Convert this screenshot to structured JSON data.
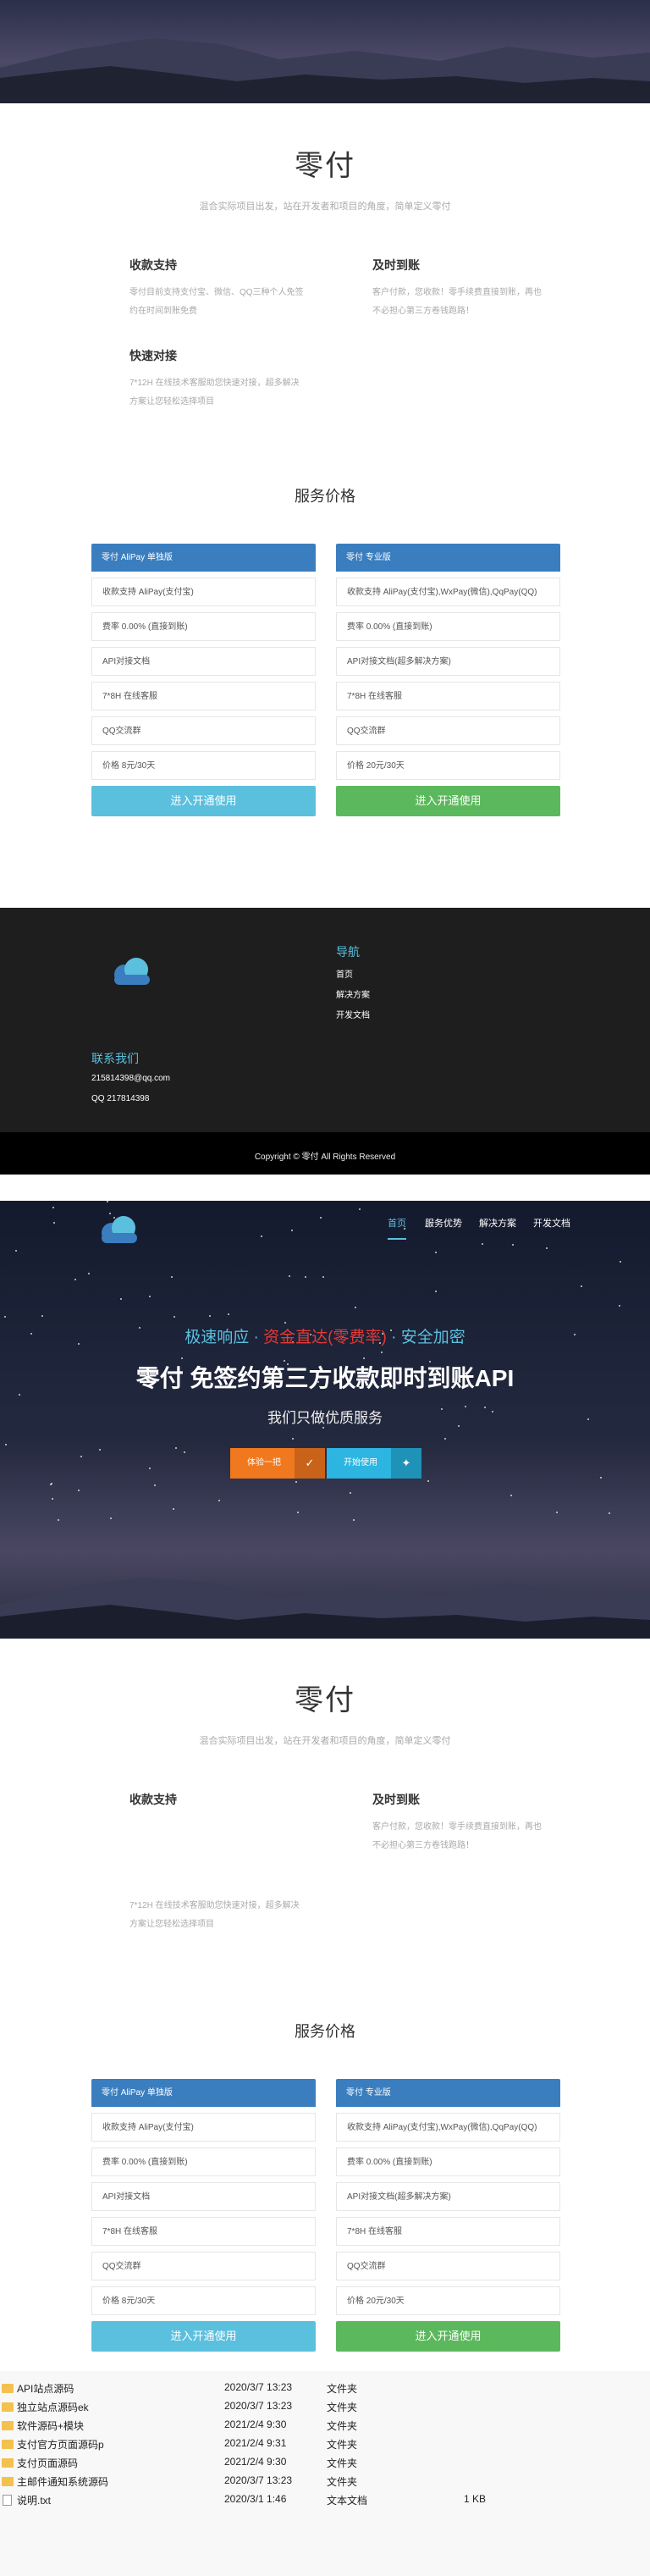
{
  "brand": {
    "title": "零付",
    "subtitle": "混合实际项目出发，站在开发者和项目的角度，简单定义零付"
  },
  "features": {
    "f1": {
      "title": "收款支持",
      "desc1": "零付目前支持支付宝、微信、QQ三种个人免签",
      "desc2": "约在时间到账免费"
    },
    "f2": {
      "title": "及时到账",
      "desc1": "客户付款，您收款！零手续费直接到账，再也",
      "desc2": "不必担心第三方卷钱跑路！"
    },
    "f3": {
      "title": "快速对接",
      "desc1": "7*12H 在线技术客服助您快速对接，超多解决",
      "desc2": "方案让您轻松选择项目"
    }
  },
  "pricing": {
    "title": "服务价格",
    "basic": {
      "name": "零付 AliPay 单独版",
      "rows": [
        "收款支持 AliPay(支付宝)",
        "费率 0.00% (直接到账)",
        "API对接文档",
        "7*8H 在线客服",
        "QQ交流群",
        "价格 8元/30天"
      ],
      "button": "进入开通使用"
    },
    "pro": {
      "name": "零付 专业版",
      "rows": [
        "收款支持 AliPay(支付宝),WxPay(微信),QqPay(QQ)",
        "费率 0.00% (直接到账)",
        "API对接文档(超多解决方案)",
        "7*8H 在线客服",
        "QQ交流群",
        "价格 20元/30天"
      ],
      "button": "进入开通使用"
    }
  },
  "footer": {
    "nav_title": "导航",
    "nav": [
      "首页",
      "解决方案",
      "开发文档"
    ],
    "contact_title": "联系我们",
    "email": "215814398@qq.com",
    "qq": "QQ 217814398",
    "copyright": "Copyright © 零付 All Rights Reserved"
  },
  "hero": {
    "nav": [
      "首页",
      "服务优势",
      "解决方案",
      "开发文档"
    ],
    "tagline_a": "极速响应 · ",
    "tagline_b": "资金直达(零费率)",
    "tagline_c": " · 安全加密",
    "headline": "零付 免签约第三方收款即时到账API",
    "sub": "我们只做优质服务",
    "btn_try": "体验一把",
    "btn_start": "开始使用"
  },
  "files": [
    {
      "name": "API站点源码",
      "date": "2020/3/7 13:23",
      "type": "文件夹",
      "size": ""
    },
    {
      "name": "独立站点源码ek",
      "date": "2020/3/7 13:23",
      "type": "文件夹",
      "size": ""
    },
    {
      "name": "软件源码+模块",
      "date": "2021/2/4 9:30",
      "type": "文件夹",
      "size": ""
    },
    {
      "name": "支付官方页面源码p",
      "date": "2021/2/4 9:31",
      "type": "文件夹",
      "size": ""
    },
    {
      "name": "支付页面源码",
      "date": "2021/2/4 9:30",
      "type": "文件夹",
      "size": ""
    },
    {
      "name": "主邮件通知系统源码",
      "date": "2020/3/7 13:23",
      "type": "文件夹",
      "size": ""
    },
    {
      "name": "说明.txt",
      "date": "2020/3/1 1:46",
      "type": "文本文档",
      "size": "1 KB"
    }
  ],
  "colors": {
    "blue": "#3a7ebf",
    "green": "#5cb85c",
    "light_blue": "#5bc0de",
    "orange": "#f0781e",
    "cyan": "#2bb5e0"
  }
}
